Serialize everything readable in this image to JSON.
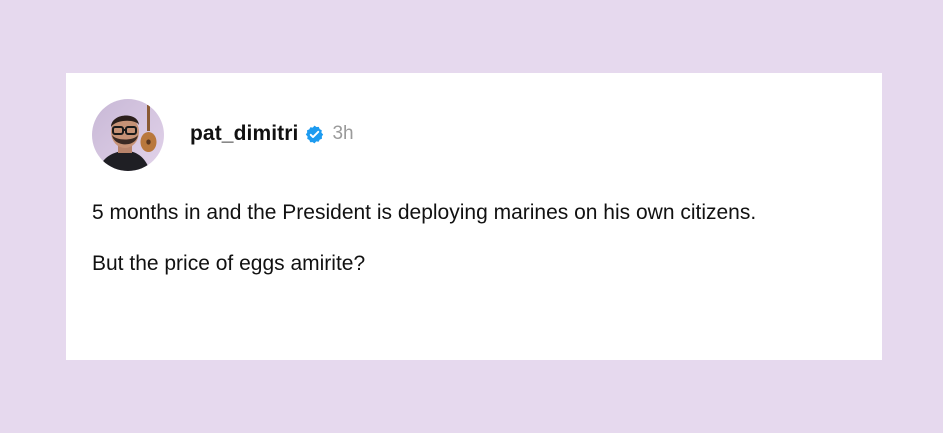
{
  "post": {
    "author": {
      "username": "pat_dimitri",
      "verified_icon": "verified-badge-icon",
      "avatar_icon": "profile-avatar"
    },
    "timestamp": "3h",
    "paragraphs": [
      "5 months in and the President is deploying marines on his own citizens.",
      "But the price of eggs amirite?"
    ]
  },
  "colors": {
    "background": "#e6d9ee",
    "card": "#ffffff",
    "text": "#111111",
    "muted": "#9a9a9a",
    "verified": "#1d9bf0"
  }
}
